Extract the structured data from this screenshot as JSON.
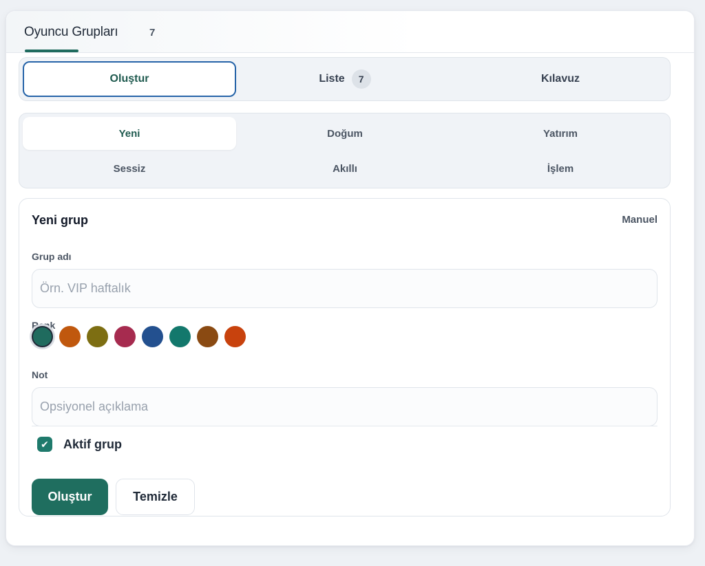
{
  "header": {
    "title": "Oyuncu Grupları",
    "count": "7"
  },
  "tabs": [
    {
      "label": "Oluştur",
      "active": true
    },
    {
      "label": "Liste",
      "badge": "7"
    },
    {
      "label": "Kılavuz"
    }
  ],
  "segments": [
    {
      "label": "Yeni",
      "active": true
    },
    {
      "label": "Doğum"
    },
    {
      "label": "Yatırım"
    },
    {
      "label": "Sessiz"
    },
    {
      "label": "Akıllı"
    },
    {
      "label": "İşlem"
    }
  ],
  "form": {
    "title": "Yeni grup",
    "mode": "Manuel",
    "name_label": "Grup adı",
    "name_placeholder": "Örn. VIP haftalık",
    "name_value": "",
    "color_label": "Renk",
    "colors": [
      "#1f6b5e",
      "#c0580e",
      "#7d6e12",
      "#a62b4f",
      "#23508f",
      "#13786c",
      "#8a4a12",
      "#c8420d"
    ],
    "selected_color": "#1f6b5e",
    "note_label": "Not",
    "note_placeholder": "Opsiyonel açıklama",
    "note_value": "",
    "active_label": "Aktif grup",
    "active_checked": true,
    "submit_label": "Oluştur",
    "clear_label": "Temizle"
  },
  "colors": {
    "accent": "#1f6e5f",
    "active_tab_border": "#2563a8"
  }
}
